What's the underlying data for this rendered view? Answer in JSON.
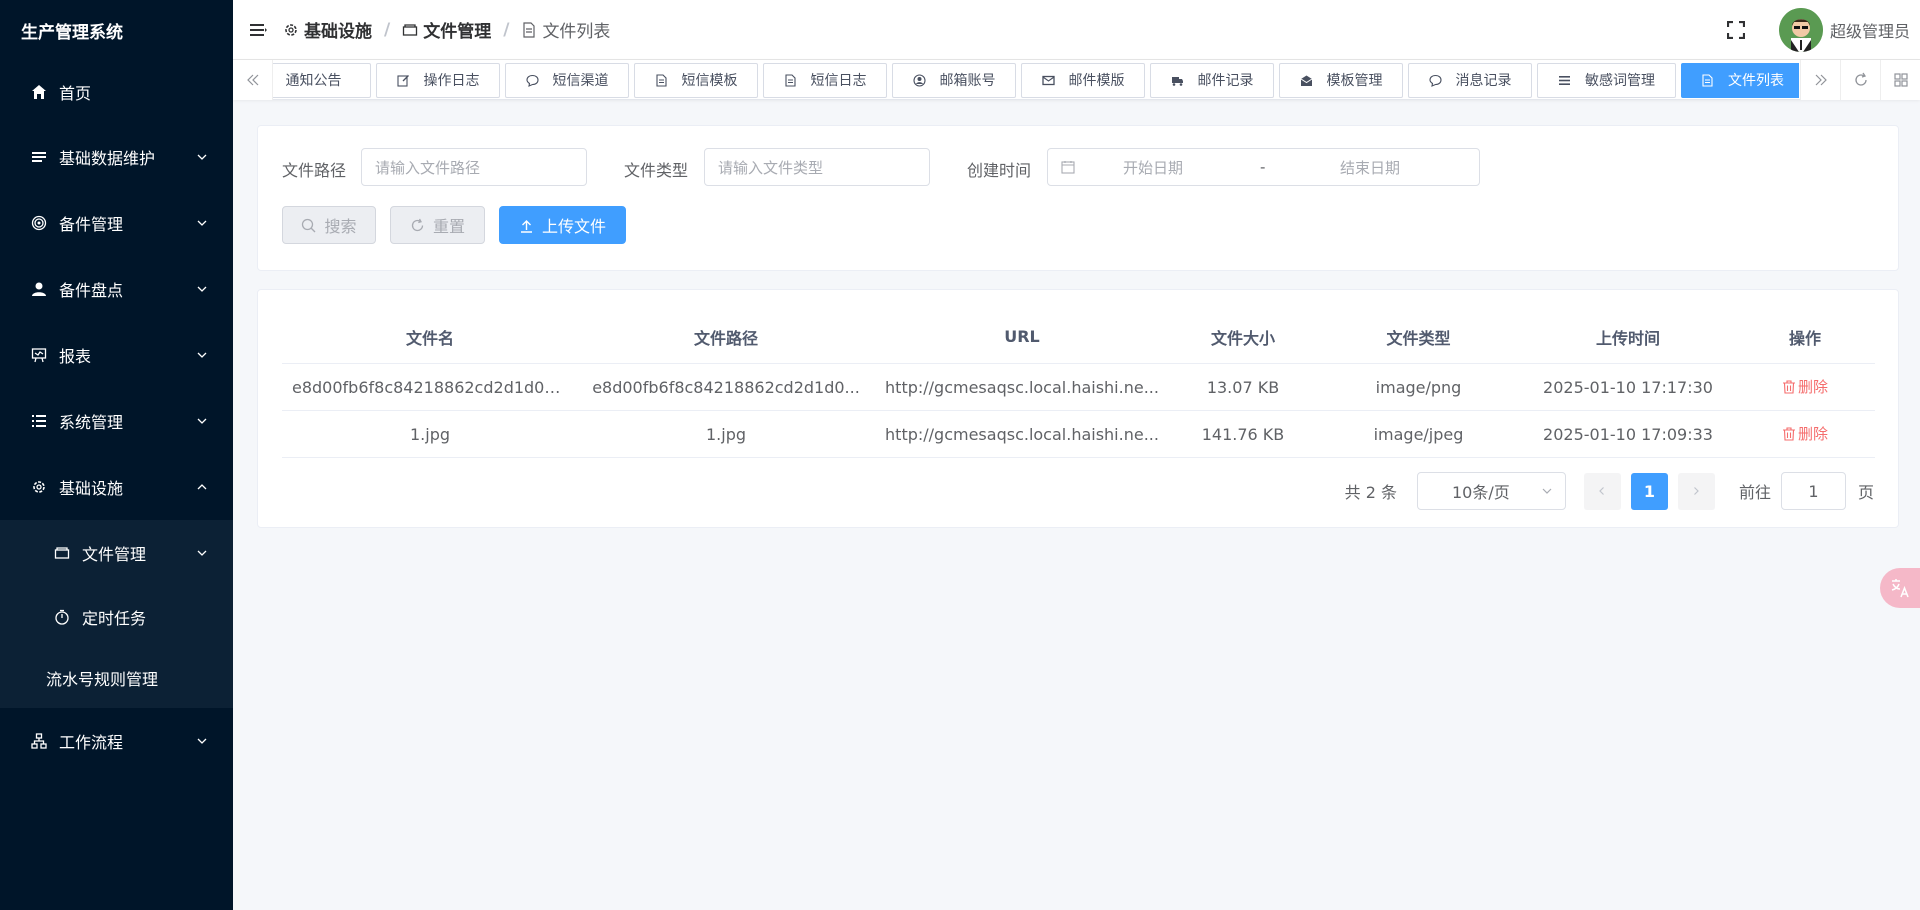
{
  "app": {
    "title": "生产管理系统"
  },
  "sidebar": {
    "items": [
      {
        "label": "首页",
        "icon": "home-icon"
      },
      {
        "label": "基础数据维护",
        "icon": "list-icon"
      },
      {
        "label": "备件管理",
        "icon": "spiral-icon"
      },
      {
        "label": "备件盘点",
        "icon": "user-icon"
      },
      {
        "label": "报表",
        "icon": "board-icon"
      },
      {
        "label": "系统管理",
        "icon": "menu-list-icon"
      },
      {
        "label": "基础设施",
        "icon": "gear-icon"
      }
    ],
    "submenu": {
      "items": [
        {
          "label": "文件管理",
          "icon": "folder-icon"
        },
        {
          "label": "定时任务",
          "icon": "timer-icon"
        },
        {
          "label": "流水号规则管理"
        }
      ]
    },
    "after": {
      "label": "工作流程",
      "icon": "flow-icon"
    }
  },
  "header": {
    "breadcrumb": [
      "基础设施",
      "文件管理",
      "文件列表"
    ],
    "username": "超级管理员"
  },
  "tags": [
    {
      "label": "通知公告",
      "icon": ""
    },
    {
      "label": "操作日志",
      "icon": "edit-icon"
    },
    {
      "label": "短信渠道",
      "icon": "message-icon"
    },
    {
      "label": "短信模板",
      "icon": "doc-icon"
    },
    {
      "label": "短信日志",
      "icon": "doc-icon"
    },
    {
      "label": "邮箱账号",
      "icon": "user-circle-icon"
    },
    {
      "label": "邮件模版",
      "icon": "mail-icon"
    },
    {
      "label": "邮件记录",
      "icon": "truck-icon"
    },
    {
      "label": "模板管理",
      "icon": "mail-open-icon"
    },
    {
      "label": "消息记录",
      "icon": "message-icon"
    },
    {
      "label": "敏感词管理",
      "icon": "menu-icon"
    },
    {
      "label": "文件列表",
      "icon": "doc-icon",
      "active": true
    }
  ],
  "search": {
    "path_label": "文件路径",
    "path_placeholder": "请输入文件路径",
    "type_label": "文件类型",
    "type_placeholder": "请输入文件类型",
    "time_label": "创建时间",
    "start_placeholder": "开始日期",
    "range_sep": "-",
    "end_placeholder": "结束日期",
    "search_btn": "搜索",
    "reset_btn": "重置",
    "upload_btn": "上传文件"
  },
  "table": {
    "columns": [
      "文件名",
      "文件路径",
      "URL",
      "文件大小",
      "文件类型",
      "上传时间",
      "操作"
    ],
    "rows": [
      {
        "name": "e8d00fb6f8c84218862cd2d1d0d...",
        "path": "e8d00fb6f8c84218862cd2d1d0...",
        "url": "http://gcmesaqsc.local.haishi.ne...",
        "size": "13.07 KB",
        "type": "image/png",
        "time": "2025-01-10 17:17:30",
        "action": "删除"
      },
      {
        "name": "1.jpg",
        "path": "1.jpg",
        "url": "http://gcmesaqsc.local.haishi.ne...",
        "size": "141.76 KB",
        "type": "image/jpeg",
        "time": "2025-01-10 17:09:33",
        "action": "删除"
      }
    ]
  },
  "pagination": {
    "total": "共 2 条",
    "page_size": "10条/页",
    "current_page": "1",
    "goto_label": "前往",
    "goto_value": "1",
    "page_suffix": "页"
  },
  "colors": {
    "sidebar_bg": "#001529",
    "primary": "#409eff",
    "danger": "#f56c6c"
  }
}
